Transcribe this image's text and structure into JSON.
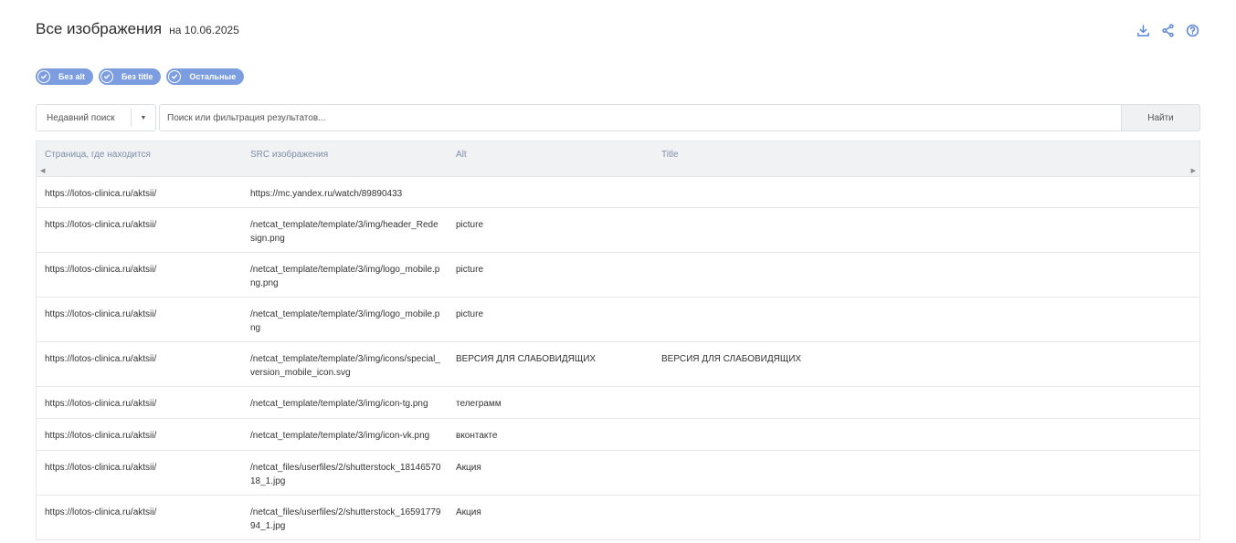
{
  "header": {
    "title": "Все изображения",
    "date": "на 10.06.2025",
    "actions": [
      "download-icon",
      "share-icon",
      "help-icon"
    ]
  },
  "filters": [
    {
      "label": "Без alt",
      "checked": true
    },
    {
      "label": "Без title",
      "checked": true
    },
    {
      "label": "Остальные",
      "checked": true
    }
  ],
  "search": {
    "recent_label": "Недавний поиск",
    "placeholder": "Поиск или фильтрация результатов...",
    "value": "",
    "button_label": "Найти"
  },
  "table": {
    "columns": [
      "Страница, где находится",
      "SRC изображения",
      "Alt",
      "Title"
    ],
    "rows": [
      [
        "https://lotos-clinica.ru/aktsii/",
        "https://mc.yandex.ru/watch/89890433",
        "",
        ""
      ],
      [
        "https://lotos-clinica.ru/aktsii/",
        "/netcat_template/template/3/img/header_Redesign.png",
        "picture",
        ""
      ],
      [
        "https://lotos-clinica.ru/aktsii/",
        "/netcat_template/template/3/img/logo_mobile.png.png",
        "picture",
        ""
      ],
      [
        "https://lotos-clinica.ru/aktsii/",
        "/netcat_template/template/3/img/logo_mobile.png",
        "picture",
        ""
      ],
      [
        "https://lotos-clinica.ru/aktsii/",
        "/netcat_template/template/3/img/icons/special_version_mobile_icon.svg",
        "ВЕРСИЯ ДЛЯ СЛАБОВИДЯЩИХ",
        "ВЕРСИЯ ДЛЯ СЛАБОВИДЯЩИХ"
      ],
      [
        "https://lotos-clinica.ru/aktsii/",
        "/netcat_template/template/3/img/icon-tg.png",
        "телеграмм",
        ""
      ],
      [
        "https://lotos-clinica.ru/aktsii/",
        "/netcat_template/template/3/img/icon-vk.png",
        "вконтакте",
        ""
      ],
      [
        "https://lotos-clinica.ru/aktsii/",
        "/netcat_files/userfiles/2/shutterstock_1814657018_1.jpg",
        "Акция",
        ""
      ],
      [
        "https://lotos-clinica.ru/aktsii/",
        "/netcat_files/userfiles/2/shutterstock_1659177994_1.jpg",
        "Акция",
        ""
      ]
    ]
  },
  "colors": {
    "accent": "#7c9ee0",
    "icon": "#5a87d8",
    "header_bg": "#f1f2f4",
    "border": "#e4e6ea"
  }
}
